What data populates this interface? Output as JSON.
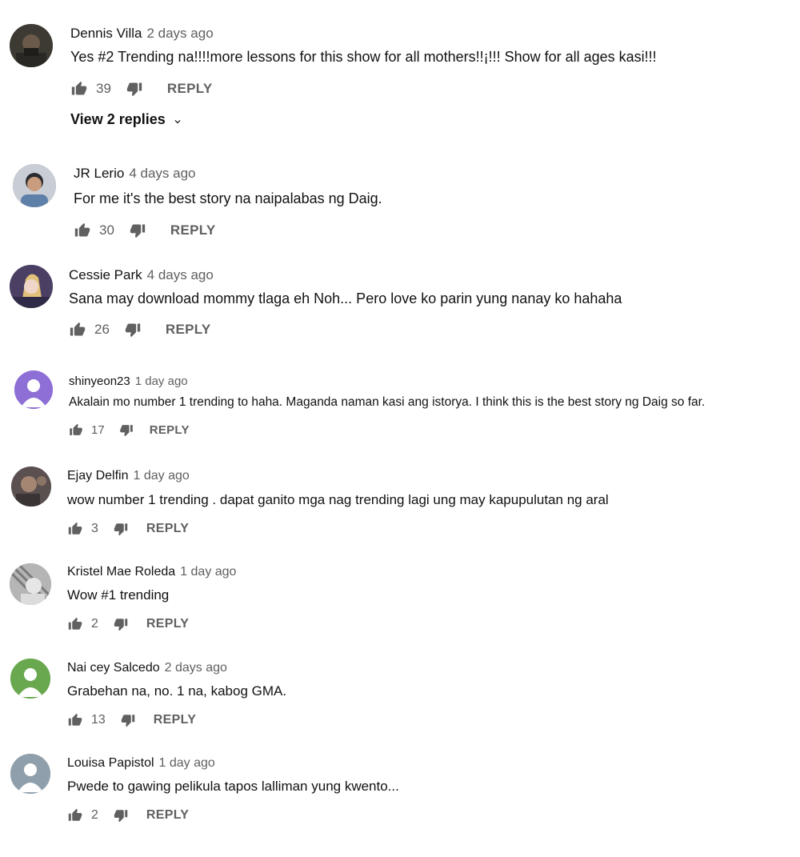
{
  "comments": [
    {
      "author": "Dennis Villa",
      "time": "2 days ago",
      "text": "Yes #2 Trending na!!!!more lessons for this show for all mothers!!¡!!! Show for all ages kasi!!!",
      "likes": "39",
      "reply": "REPLY",
      "avatar_color": "#4a4a44"
    },
    {
      "author": "JR Lerio",
      "time": "4 days ago",
      "text": "For me it's the best story na naipalabas ng Daig.",
      "likes": "30",
      "reply": "REPLY",
      "avatar_color": "#7a8594"
    },
    {
      "author": "Cessie Park",
      "time": "4 days ago",
      "text": "Sana may download mommy tlaga eh Noh... Pero love ko parin yung nanay ko hahaha",
      "likes": "26",
      "reply": "REPLY",
      "avatar_color": "#5a4a6e"
    },
    {
      "author": "shinyeon23",
      "time": "1 day ago",
      "text": "Akalain mo number 1 trending to haha. Maganda naman kasi ang istorya. I think this is the best story ng Daig so far.",
      "likes": "17",
      "reply": "REPLY",
      "avatar_color": "#8e6fd6"
    },
    {
      "author": "Ejay Delfin",
      "time": "1 day ago",
      "text": "wow number 1 trending . dapat ganito mga nag trending lagi ung may kapupulutan ng aral",
      "likes": "3",
      "reply": "REPLY",
      "avatar_color": "#5b5050"
    },
    {
      "author": "Kristel Mae Roleda",
      "time": "1 day ago",
      "text": "Wow #1 trending",
      "likes": "2",
      "reply": "REPLY",
      "avatar_color": "#9a9a9a"
    },
    {
      "author": "Nai cey Salcedo",
      "time": "2 days ago",
      "text": "Grabehan na, no. 1 na, kabog GMA.",
      "likes": "13",
      "reply": "REPLY",
      "avatar_color": "#6aa84f"
    },
    {
      "author": "Louisa Papistol",
      "time": "1 day ago",
      "text": "Pwede to gawing pelikula tapos lalliman yung kwento...",
      "likes": "2",
      "reply": "REPLY",
      "avatar_color": "#8fa0ac"
    }
  ],
  "view_replies": "View 2 replies",
  "icons": {
    "like": "thumb-up-icon",
    "dislike": "thumb-down-icon",
    "chevron": "chevron-down-icon",
    "avatar": "person-avatar-icon"
  }
}
